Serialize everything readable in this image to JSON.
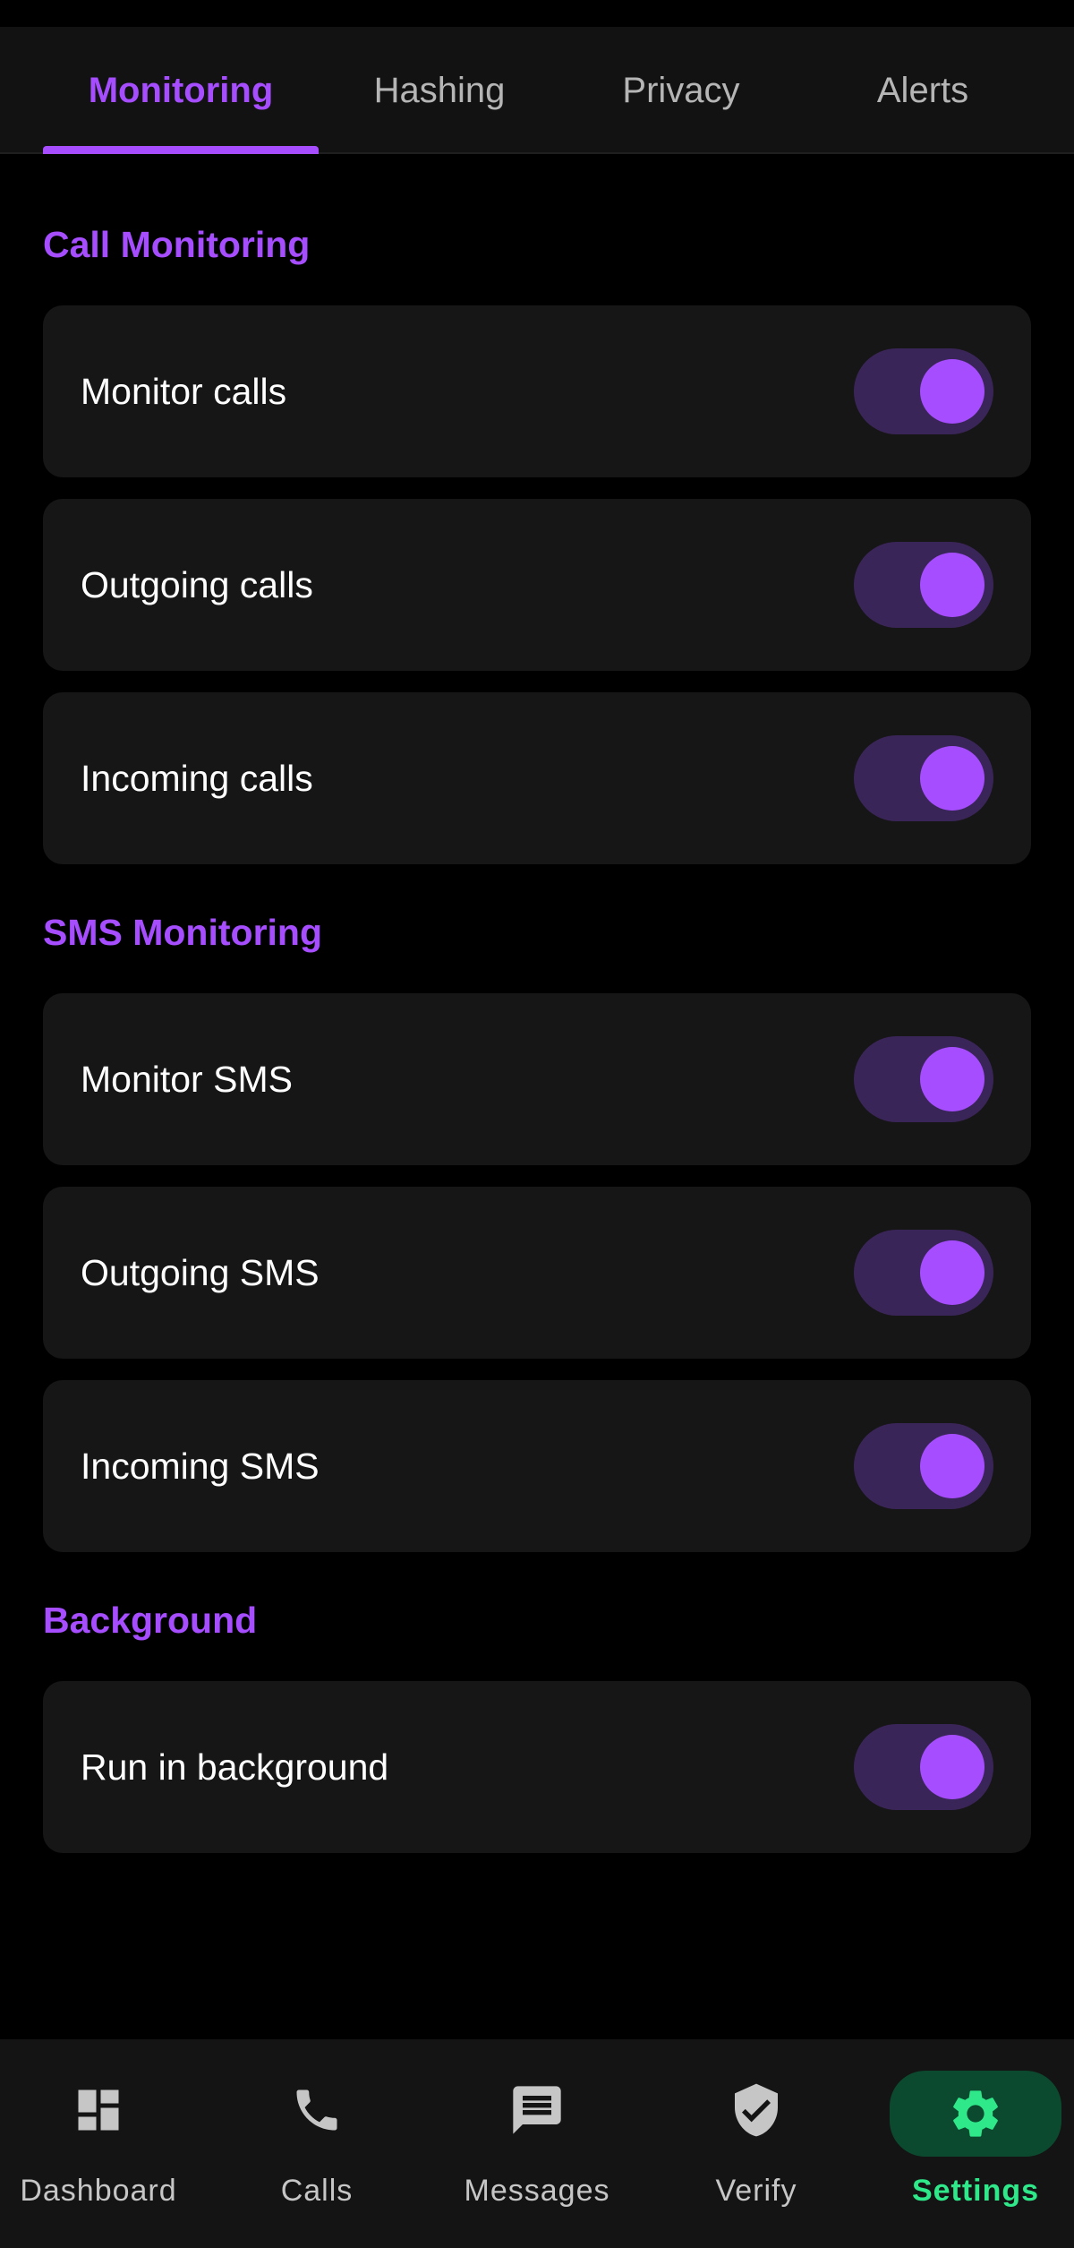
{
  "tabs": [
    {
      "label": "Monitoring",
      "active": true
    },
    {
      "label": "Hashing",
      "active": false
    },
    {
      "label": "Privacy",
      "active": false
    },
    {
      "label": "Alerts",
      "active": false
    }
  ],
  "sections": {
    "call": {
      "title": "Call Monitoring",
      "items": [
        {
          "label": "Monitor calls",
          "enabled": true
        },
        {
          "label": "Outgoing calls",
          "enabled": true
        },
        {
          "label": "Incoming calls",
          "enabled": true
        }
      ]
    },
    "sms": {
      "title": "SMS Monitoring",
      "items": [
        {
          "label": "Monitor SMS",
          "enabled": true
        },
        {
          "label": "Outgoing SMS",
          "enabled": true
        },
        {
          "label": "Incoming SMS",
          "enabled": true
        }
      ]
    },
    "background": {
      "title": "Background",
      "items": [
        {
          "label": "Run in background",
          "enabled": true
        }
      ]
    }
  },
  "bottom_nav": [
    {
      "label": "Dashboard",
      "icon": "dashboard-icon",
      "active": false
    },
    {
      "label": "Calls",
      "icon": "phone-icon",
      "active": false
    },
    {
      "label": "Messages",
      "icon": "message-icon",
      "active": false
    },
    {
      "label": "Verify",
      "icon": "shield-check-icon",
      "active": false
    },
    {
      "label": "Settings",
      "icon": "gear-icon",
      "active": true
    }
  ],
  "colors": {
    "accent": "#a64dff",
    "toggle_track": "#3a2558",
    "card_bg": "#161616",
    "nav_active": "#2ee889",
    "nav_active_pill": "#0c4a2f"
  }
}
